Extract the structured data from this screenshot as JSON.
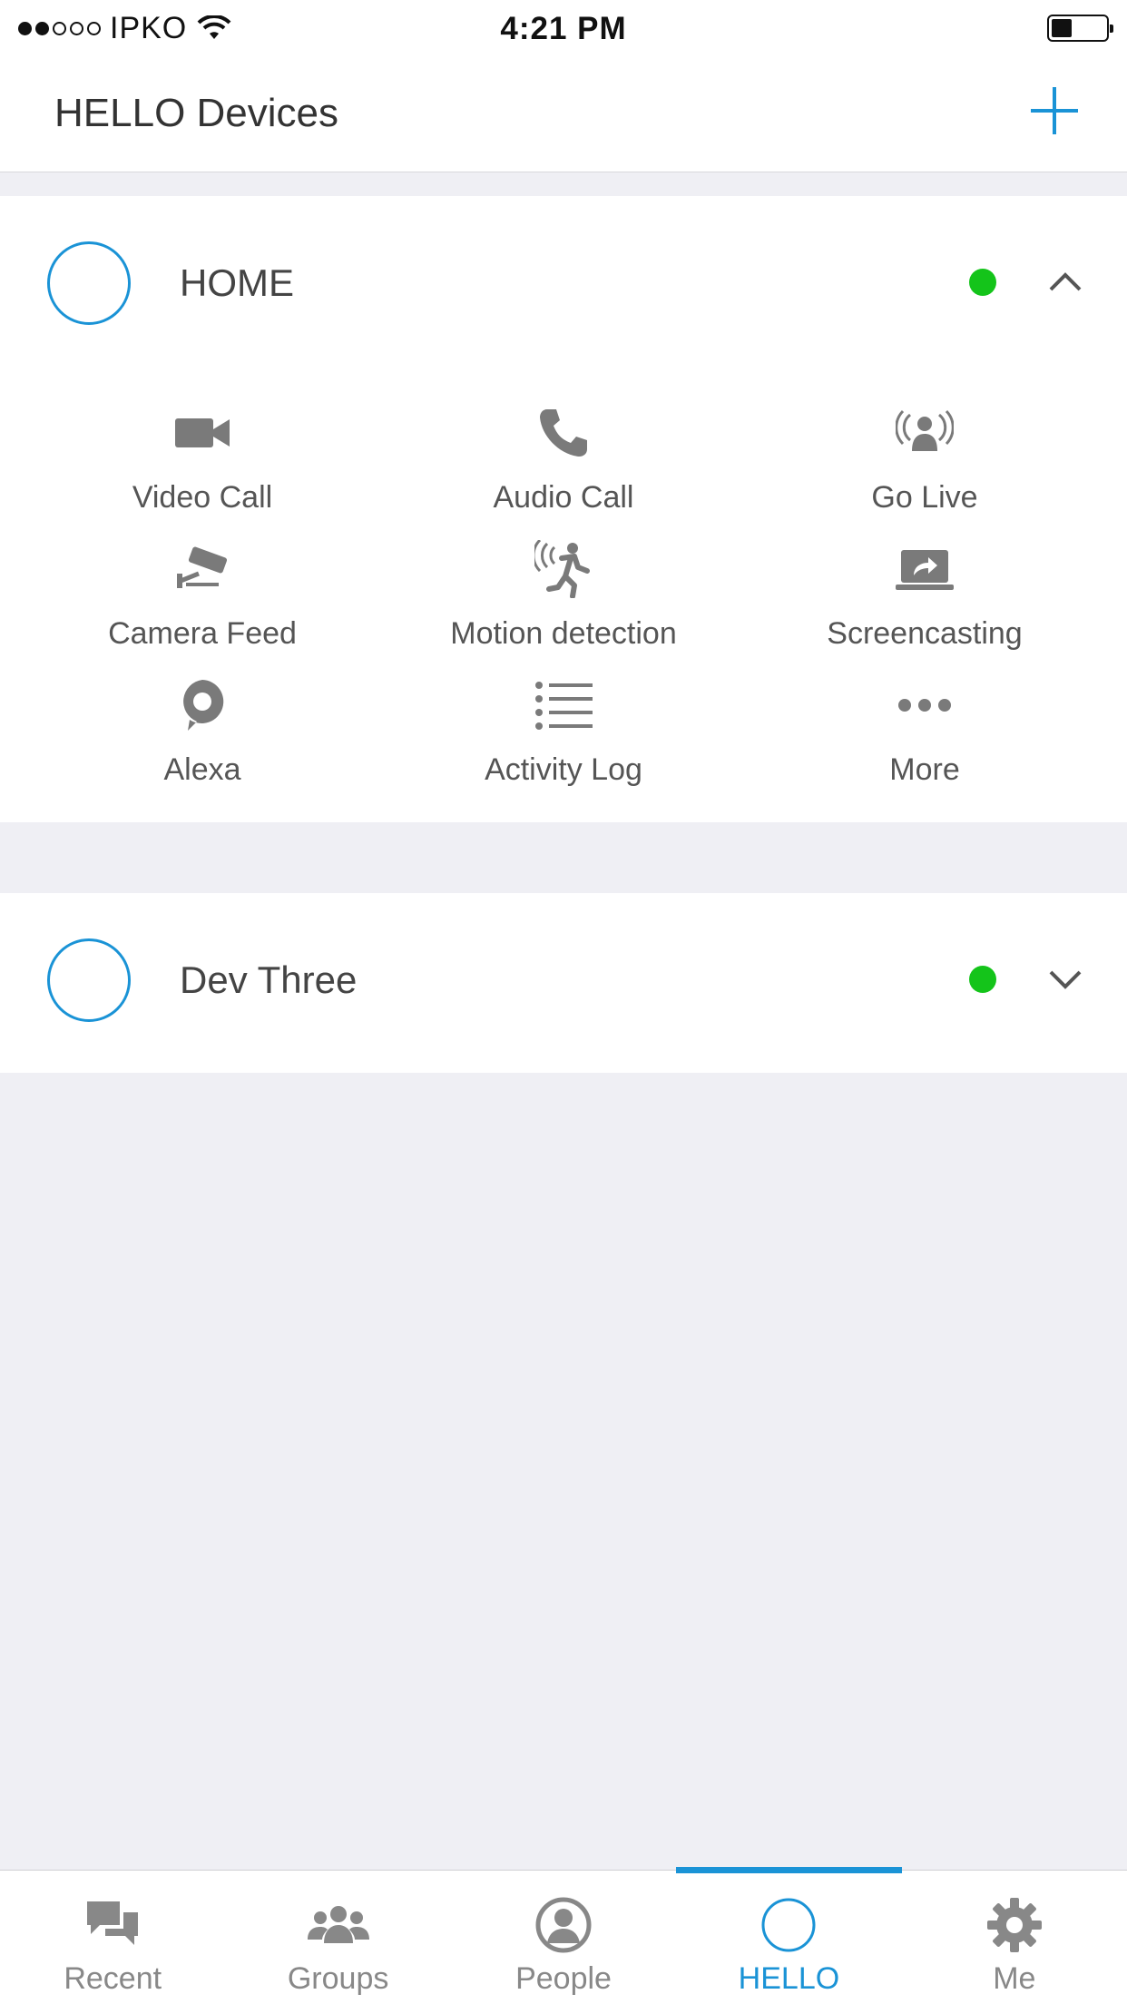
{
  "status_bar": {
    "carrier": "IPKO",
    "time": "4:21 PM",
    "signal_filled": 2,
    "signal_total": 5,
    "battery_level": 0.35
  },
  "nav": {
    "title": "HELLO Devices",
    "add_icon": "plus-icon"
  },
  "devices": [
    {
      "name": "HOME",
      "online": true,
      "expanded": true,
      "features": [
        {
          "label": "Video Call",
          "icon": "video-camera-icon"
        },
        {
          "label": "Audio Call",
          "icon": "phone-icon"
        },
        {
          "label": "Go Live",
          "icon": "broadcast-icon"
        },
        {
          "label": "Camera Feed",
          "icon": "security-camera-icon"
        },
        {
          "label": "Motion detection",
          "icon": "motion-icon"
        },
        {
          "label": "Screencasting",
          "icon": "screencast-icon"
        },
        {
          "label": "Alexa",
          "icon": "alexa-icon"
        },
        {
          "label": "Activity Log",
          "icon": "list-icon"
        },
        {
          "label": "More",
          "icon": "more-icon"
        }
      ]
    },
    {
      "name": "Dev Three",
      "online": true,
      "expanded": false
    }
  ],
  "tabs": [
    {
      "label": "Recent",
      "icon": "chat-bubbles-icon",
      "active": false
    },
    {
      "label": "Groups",
      "icon": "group-icon",
      "active": false
    },
    {
      "label": "People",
      "icon": "person-icon",
      "active": false
    },
    {
      "label": "HELLO",
      "icon": "hello-ring-icon",
      "active": true
    },
    {
      "label": "Me",
      "icon": "gear-icon",
      "active": false
    }
  ],
  "colors": {
    "accent": "#1a93d6",
    "online": "#14c41a",
    "icon_gray": "#7a7a7a",
    "background": "#efeff4"
  }
}
